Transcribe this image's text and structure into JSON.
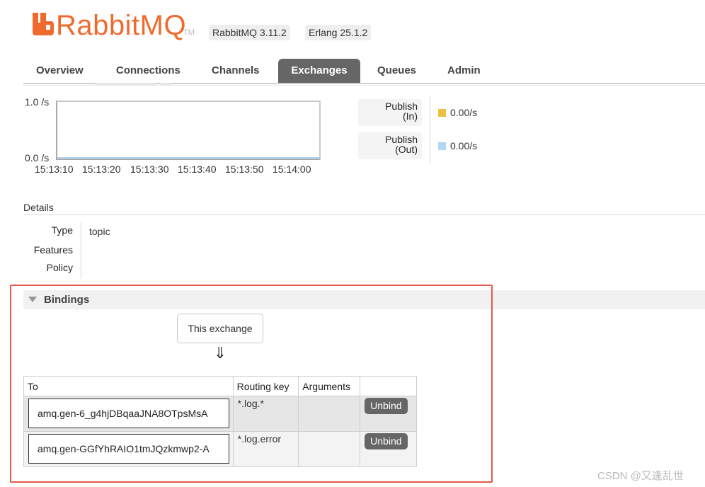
{
  "header": {
    "logo": "RabbitMQ",
    "tm": "TM",
    "version_badge": "RabbitMQ 3.11.2",
    "erlang_badge": "Erlang 25.1.2"
  },
  "tabs": [
    {
      "label": "Overview",
      "active": false
    },
    {
      "label": "Connections",
      "active": false
    },
    {
      "label": "Channels",
      "active": false
    },
    {
      "label": "Exchanges",
      "active": true
    },
    {
      "label": "Queues",
      "active": false
    },
    {
      "label": "Admin",
      "active": false
    }
  ],
  "rates_chart": {
    "y_max_label": "1.0 /s",
    "y_min_label": "0.0 /s",
    "x_ticks": [
      "15:13:10",
      "15:13:20",
      "15:13:30",
      "15:13:40",
      "15:13:50",
      "15:14:00"
    ],
    "legend": [
      {
        "label_line1": "Publish",
        "label_line2": "(In)",
        "value": "0.00/s",
        "color": "#edc240"
      },
      {
        "label_line1": "Publish",
        "label_line2": "(Out)",
        "value": "0.00/s",
        "color": "#afd8f8"
      }
    ]
  },
  "chart_data": {
    "type": "line",
    "x": [
      "15:13:10",
      "15:13:20",
      "15:13:30",
      "15:13:40",
      "15:13:50",
      "15:14:00"
    ],
    "series": [
      {
        "name": "Publish (In)",
        "values": [
          0,
          0,
          0,
          0,
          0,
          0
        ]
      },
      {
        "name": "Publish (Out)",
        "values": [
          0,
          0,
          0,
          0,
          0,
          0
        ]
      }
    ],
    "ylim": [
      0.0,
      1.0
    ]
  },
  "details": {
    "title": "Details",
    "rows": [
      {
        "label": "Type",
        "value": "topic"
      },
      {
        "label": "Features",
        "value": ""
      },
      {
        "label": "Policy",
        "value": ""
      }
    ]
  },
  "bindings": {
    "title": "Bindings",
    "this_exchange": "This exchange",
    "arrow": "⇓",
    "columns": [
      "To",
      "Routing key",
      "Arguments",
      ""
    ],
    "rows": [
      {
        "to": "amq.gen-6_g4hjDBqaaJNA8OTpsMsA",
        "routing_key": "*.log.*",
        "arguments": "",
        "action": "Unbind"
      },
      {
        "to": "amq.gen-GGfYhRAIO1tmJQzkmwp2-A",
        "routing_key": "*.log.error",
        "arguments": "",
        "action": "Unbind"
      }
    ]
  },
  "watermark": "CSDN @又逢乱世"
}
